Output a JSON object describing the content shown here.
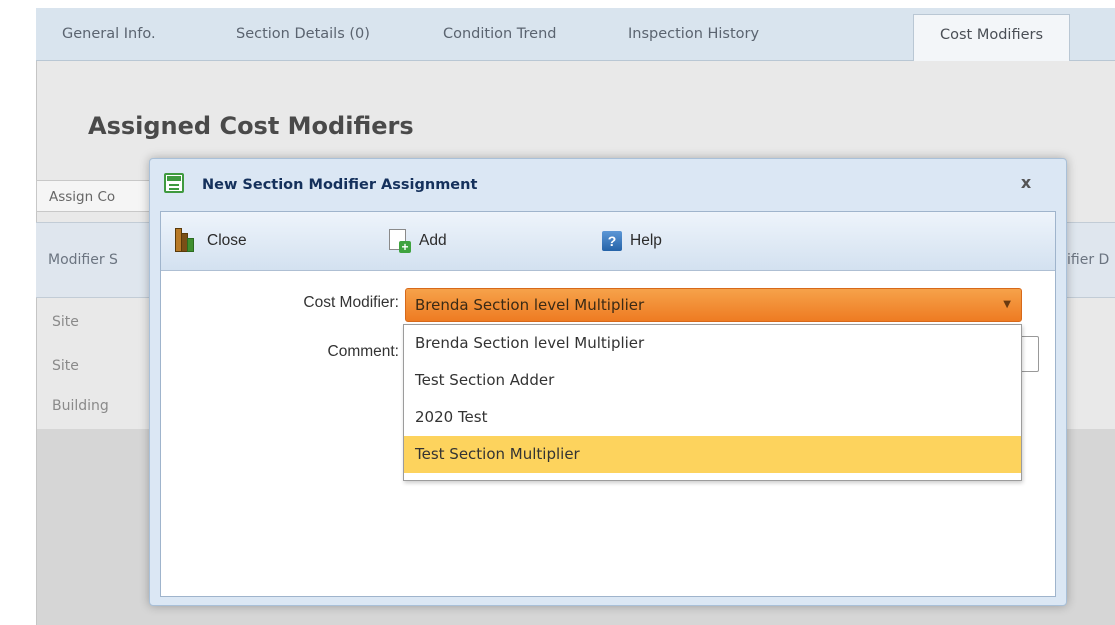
{
  "tabs": [
    {
      "label": "General Info."
    },
    {
      "label": "Section Details (0)"
    },
    {
      "label": "Condition Trend"
    },
    {
      "label": "Inspection History"
    },
    {
      "label": "Cost Modifiers",
      "active": true
    }
  ],
  "page": {
    "title": "Assigned Cost Modifiers",
    "assign_button": "Assign Co",
    "grid_headers": [
      "Modifier S",
      "ifier D"
    ],
    "rows": [
      "Site",
      "Site",
      "Building"
    ]
  },
  "dialog": {
    "title": "New Section Modifier Assignment",
    "close_glyph": "x",
    "toolbar": {
      "close_label": "Close",
      "add_label": "Add",
      "help_label": "Help",
      "help_glyph": "?",
      "add_glyph": "+"
    },
    "cost_modifier_label": "Cost Modifier:",
    "cost_modifier_value": "Brenda Section level Multiplier",
    "comment_label": "Comment:",
    "comment_value": "",
    "options": [
      "Brenda Section level Multiplier",
      "Test Section Adder",
      "2020 Test",
      "Test Section Multiplier"
    ],
    "highlighted_option": "Test Section Multiplier"
  },
  "colors": {
    "select_accent": "#ee7b22",
    "highlight": "#fdd35d",
    "dialog_title": "#15315c"
  }
}
